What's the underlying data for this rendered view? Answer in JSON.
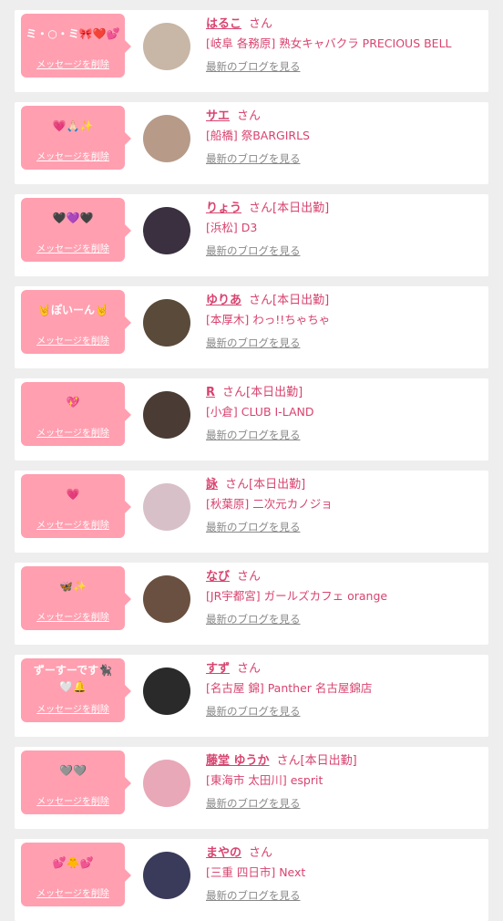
{
  "delete_label": "メッセージを削除",
  "blog_label": "最新のブログを見る",
  "suffix": "さん",
  "cards": [
    {
      "message": "ミ・○・ミ🎀❤️💕",
      "name": "はるこ",
      "status": "",
      "shop": "[岐阜 各務原] 熟女キャバクラ PRECIOUS BELL",
      "avatar_color": "#c8b6a6"
    },
    {
      "message": "💗🙏🏻✨",
      "name": "サエ",
      "status": "",
      "shop": "[船橋] 祭BARGIRLS",
      "avatar_color": "#b79a88"
    },
    {
      "message": "🖤💜🖤",
      "name": "りょう",
      "status": "[本日出勤]",
      "shop": "[浜松] D3",
      "avatar_color": "#3a3040"
    },
    {
      "message": "🤘ぽいーん🤘",
      "name": "ゆりあ",
      "status": "[本日出勤]",
      "shop": "[本厚木] わっ!!ちゃちゃ",
      "avatar_color": "#5a4a3a"
    },
    {
      "message": "💖",
      "name": "R",
      "status": "[本日出勤]",
      "shop": "[小倉] CLUB I-LAND",
      "avatar_color": "#4a3c34"
    },
    {
      "message": "💗",
      "name": "詠",
      "status": "[本日出勤]",
      "shop": "[秋葉原] 二次元カノジョ",
      "avatar_color": "#d8c0c8"
    },
    {
      "message": "🦋✨",
      "name": "なび",
      "status": "",
      "shop": "[JR宇都宮] ガールズカフェ orange",
      "avatar_color": "#6a5040"
    },
    {
      "message": "ずーすーです🐈‍⬛\n🤍🔔",
      "name": "すず",
      "status": "",
      "shop": "[名古屋 錦] Panther 名古屋錦店",
      "avatar_color": "#2a2a2a"
    },
    {
      "message": "🩶🩶",
      "name": "藤堂 ゆうか",
      "status": "[本日出勤]",
      "shop": "[東海市 太田川] esprit",
      "avatar_color": "#e8a8b8"
    },
    {
      "message": "💕🐥💕",
      "name": "まやの",
      "status": "",
      "shop": "[三重 四日市] Next",
      "avatar_color": "#3a3a5a"
    }
  ]
}
